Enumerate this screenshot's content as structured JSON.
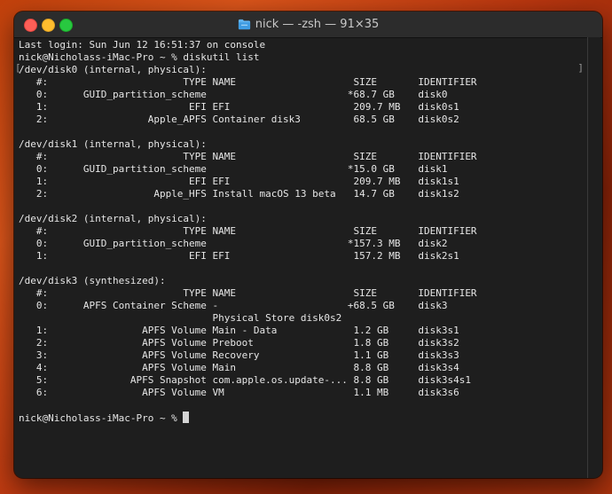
{
  "window": {
    "title": "nick — -zsh — 91×35",
    "colors": {
      "background": "#1e1e1e",
      "titlebar": "#2c2c2c",
      "text": "#e6e6e6",
      "close": "#fe5f57",
      "minimize": "#febc2e",
      "maximize": "#28c840"
    }
  },
  "terminal": {
    "lines": [
      "Last login: Sun Jun 12 16:51:37 on console",
      "nick@Nicholass-iMac-Pro ~ % diskutil list",
      "/dev/disk0 (internal, physical):",
      "   #:                       TYPE NAME                    SIZE       IDENTIFIER",
      "   0:      GUID_partition_scheme                        *68.7 GB    disk0",
      "   1:                        EFI EFI                     209.7 MB   disk0s1",
      "   2:                 Apple_APFS Container disk3         68.5 GB    disk0s2",
      "",
      "/dev/disk1 (internal, physical):",
      "   #:                       TYPE NAME                    SIZE       IDENTIFIER",
      "   0:      GUID_partition_scheme                        *15.0 GB    disk1",
      "   1:                        EFI EFI                     209.7 MB   disk1s1",
      "   2:                  Apple_HFS Install macOS 13 beta   14.7 GB    disk1s2",
      "",
      "/dev/disk2 (internal, physical):",
      "   #:                       TYPE NAME                    SIZE       IDENTIFIER",
      "   0:      GUID_partition_scheme                        *157.3 MB   disk2",
      "   1:                        EFI EFI                     157.2 MB   disk2s1",
      "",
      "/dev/disk3 (synthesized):",
      "   #:                       TYPE NAME                    SIZE       IDENTIFIER",
      "   0:      APFS Container Scheme -                      +68.5 GB    disk3",
      "                                 Physical Store disk0s2",
      "   1:                APFS Volume Main - Data             1.2 GB     disk3s1",
      "   2:                APFS Volume Preboot                 1.8 GB     disk3s2",
      "   3:                APFS Volume Recovery                1.1 GB     disk3s3",
      "   4:                APFS Volume Main                    8.8 GB     disk3s4",
      "   5:              APFS Snapshot com.apple.os.update-... 8.8 GB     disk3s4s1",
      "   6:                APFS Volume VM                      1.1 MB     disk3s6",
      ""
    ],
    "prompt": "nick@Nicholass-iMac-Pro ~ % "
  }
}
